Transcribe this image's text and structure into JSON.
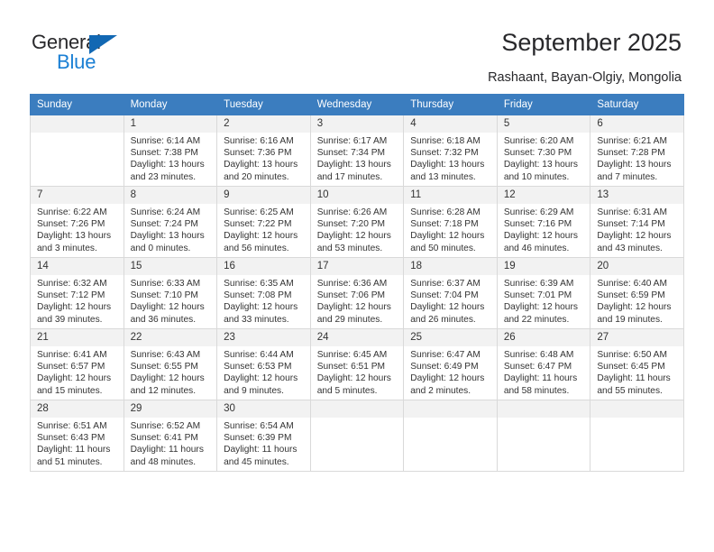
{
  "brand": {
    "name_dark": "General",
    "name_blue": "Blue",
    "triangle_color": "#1268b3",
    "blue_color": "#1a7fd4"
  },
  "header": {
    "title": "September 2025",
    "subtitle": "Rashaant, Bayan-Olgiy, Mongolia"
  },
  "colors": {
    "header_row_bg": "#3b7dbf",
    "header_row_text": "#ffffff",
    "daynum_bg": "#f2f2f2",
    "grid_border": "#d9d9d9",
    "body_text": "#333333"
  },
  "weekdays": [
    "Sunday",
    "Monday",
    "Tuesday",
    "Wednesday",
    "Thursday",
    "Friday",
    "Saturday"
  ],
  "weeks": [
    [
      {
        "day": "",
        "lines": []
      },
      {
        "day": "1",
        "lines": [
          "Sunrise: 6:14 AM",
          "Sunset: 7:38 PM",
          "Daylight: 13 hours",
          "and 23 minutes."
        ]
      },
      {
        "day": "2",
        "lines": [
          "Sunrise: 6:16 AM",
          "Sunset: 7:36 PM",
          "Daylight: 13 hours",
          "and 20 minutes."
        ]
      },
      {
        "day": "3",
        "lines": [
          "Sunrise: 6:17 AM",
          "Sunset: 7:34 PM",
          "Daylight: 13 hours",
          "and 17 minutes."
        ]
      },
      {
        "day": "4",
        "lines": [
          "Sunrise: 6:18 AM",
          "Sunset: 7:32 PM",
          "Daylight: 13 hours",
          "and 13 minutes."
        ]
      },
      {
        "day": "5",
        "lines": [
          "Sunrise: 6:20 AM",
          "Sunset: 7:30 PM",
          "Daylight: 13 hours",
          "and 10 minutes."
        ]
      },
      {
        "day": "6",
        "lines": [
          "Sunrise: 6:21 AM",
          "Sunset: 7:28 PM",
          "Daylight: 13 hours",
          "and 7 minutes."
        ]
      }
    ],
    [
      {
        "day": "7",
        "lines": [
          "Sunrise: 6:22 AM",
          "Sunset: 7:26 PM",
          "Daylight: 13 hours",
          "and 3 minutes."
        ]
      },
      {
        "day": "8",
        "lines": [
          "Sunrise: 6:24 AM",
          "Sunset: 7:24 PM",
          "Daylight: 13 hours",
          "and 0 minutes."
        ]
      },
      {
        "day": "9",
        "lines": [
          "Sunrise: 6:25 AM",
          "Sunset: 7:22 PM",
          "Daylight: 12 hours",
          "and 56 minutes."
        ]
      },
      {
        "day": "10",
        "lines": [
          "Sunrise: 6:26 AM",
          "Sunset: 7:20 PM",
          "Daylight: 12 hours",
          "and 53 minutes."
        ]
      },
      {
        "day": "11",
        "lines": [
          "Sunrise: 6:28 AM",
          "Sunset: 7:18 PM",
          "Daylight: 12 hours",
          "and 50 minutes."
        ]
      },
      {
        "day": "12",
        "lines": [
          "Sunrise: 6:29 AM",
          "Sunset: 7:16 PM",
          "Daylight: 12 hours",
          "and 46 minutes."
        ]
      },
      {
        "day": "13",
        "lines": [
          "Sunrise: 6:31 AM",
          "Sunset: 7:14 PM",
          "Daylight: 12 hours",
          "and 43 minutes."
        ]
      }
    ],
    [
      {
        "day": "14",
        "lines": [
          "Sunrise: 6:32 AM",
          "Sunset: 7:12 PM",
          "Daylight: 12 hours",
          "and 39 minutes."
        ]
      },
      {
        "day": "15",
        "lines": [
          "Sunrise: 6:33 AM",
          "Sunset: 7:10 PM",
          "Daylight: 12 hours",
          "and 36 minutes."
        ]
      },
      {
        "day": "16",
        "lines": [
          "Sunrise: 6:35 AM",
          "Sunset: 7:08 PM",
          "Daylight: 12 hours",
          "and 33 minutes."
        ]
      },
      {
        "day": "17",
        "lines": [
          "Sunrise: 6:36 AM",
          "Sunset: 7:06 PM",
          "Daylight: 12 hours",
          "and 29 minutes."
        ]
      },
      {
        "day": "18",
        "lines": [
          "Sunrise: 6:37 AM",
          "Sunset: 7:04 PM",
          "Daylight: 12 hours",
          "and 26 minutes."
        ]
      },
      {
        "day": "19",
        "lines": [
          "Sunrise: 6:39 AM",
          "Sunset: 7:01 PM",
          "Daylight: 12 hours",
          "and 22 minutes."
        ]
      },
      {
        "day": "20",
        "lines": [
          "Sunrise: 6:40 AM",
          "Sunset: 6:59 PM",
          "Daylight: 12 hours",
          "and 19 minutes."
        ]
      }
    ],
    [
      {
        "day": "21",
        "lines": [
          "Sunrise: 6:41 AM",
          "Sunset: 6:57 PM",
          "Daylight: 12 hours",
          "and 15 minutes."
        ]
      },
      {
        "day": "22",
        "lines": [
          "Sunrise: 6:43 AM",
          "Sunset: 6:55 PM",
          "Daylight: 12 hours",
          "and 12 minutes."
        ]
      },
      {
        "day": "23",
        "lines": [
          "Sunrise: 6:44 AM",
          "Sunset: 6:53 PM",
          "Daylight: 12 hours",
          "and 9 minutes."
        ]
      },
      {
        "day": "24",
        "lines": [
          "Sunrise: 6:45 AM",
          "Sunset: 6:51 PM",
          "Daylight: 12 hours",
          "and 5 minutes."
        ]
      },
      {
        "day": "25",
        "lines": [
          "Sunrise: 6:47 AM",
          "Sunset: 6:49 PM",
          "Daylight: 12 hours",
          "and 2 minutes."
        ]
      },
      {
        "day": "26",
        "lines": [
          "Sunrise: 6:48 AM",
          "Sunset: 6:47 PM",
          "Daylight: 11 hours",
          "and 58 minutes."
        ]
      },
      {
        "day": "27",
        "lines": [
          "Sunrise: 6:50 AM",
          "Sunset: 6:45 PM",
          "Daylight: 11 hours",
          "and 55 minutes."
        ]
      }
    ],
    [
      {
        "day": "28",
        "lines": [
          "Sunrise: 6:51 AM",
          "Sunset: 6:43 PM",
          "Daylight: 11 hours",
          "and 51 minutes."
        ]
      },
      {
        "day": "29",
        "lines": [
          "Sunrise: 6:52 AM",
          "Sunset: 6:41 PM",
          "Daylight: 11 hours",
          "and 48 minutes."
        ]
      },
      {
        "day": "30",
        "lines": [
          "Sunrise: 6:54 AM",
          "Sunset: 6:39 PM",
          "Daylight: 11 hours",
          "and 45 minutes."
        ]
      },
      {
        "day": "",
        "lines": []
      },
      {
        "day": "",
        "lines": []
      },
      {
        "day": "",
        "lines": []
      },
      {
        "day": "",
        "lines": []
      }
    ]
  ]
}
